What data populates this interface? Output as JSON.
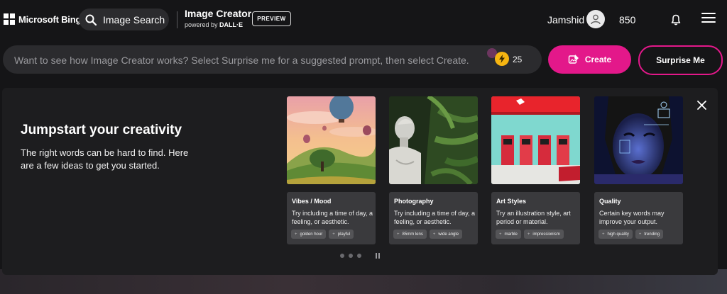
{
  "header": {
    "brand": "Microsoft Bing",
    "search_label": "Image Search",
    "app_title": "Image Creator",
    "app_subtitle_prefix": "powered by ",
    "app_subtitle_brand": "DALL·E",
    "preview_badge": "PREVIEW",
    "user_name": "Jamshid",
    "points": "850"
  },
  "prompt": {
    "placeholder": "Want to see how Image Creator works? Select Surprise me for a suggested prompt, then select Create.",
    "boosts": "25",
    "create_label": "Create",
    "surprise_label": "Surprise Me"
  },
  "panel": {
    "title": "Jumpstart your creativity",
    "description": "The right words can be hard to find. Here are a few ideas to get you started.",
    "cards": [
      {
        "title": "Vibes / Mood",
        "desc": "Try including a time of day, a feeling, or aesthetic.",
        "tags": [
          "golden hour",
          "playful"
        ]
      },
      {
        "title": "Photography",
        "desc": "Try including a time of day, a feeling, or aesthetic.",
        "tags": [
          "85mm lens",
          "wide angle"
        ]
      },
      {
        "title": "Art Styles",
        "desc": "Try an illustration style, art period or material.",
        "tags": [
          "marble",
          "impressionism"
        ]
      },
      {
        "title": "Quality",
        "desc": "Certain key words may improve your output.",
        "tags": [
          "high quality",
          "trending"
        ]
      }
    ]
  },
  "colors": {
    "accent": "#e3188a",
    "background": "#151517",
    "panel": "#1d1d1f",
    "boost": "#f6b511"
  }
}
